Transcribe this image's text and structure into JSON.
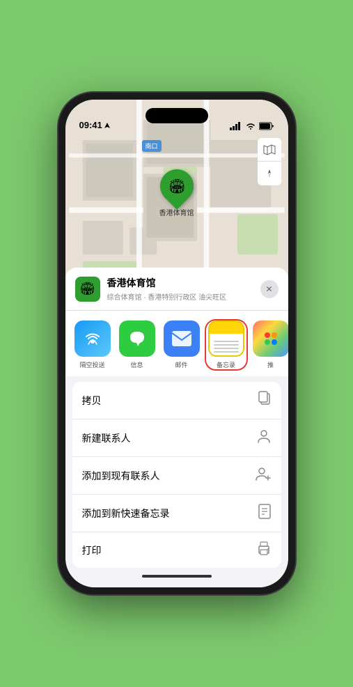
{
  "status_bar": {
    "time": "09:41",
    "location_arrow": "▶"
  },
  "map": {
    "label": "南口",
    "controls": {
      "map_icon": "🗺",
      "location_icon": "➤"
    },
    "pin": {
      "label": "香港体育馆",
      "emoji": "🏟"
    }
  },
  "venue_card": {
    "name": "香港体育馆",
    "subtitle": "综合体育馆 · 香港特别行政区 油尖旺区",
    "close_label": "✕"
  },
  "share_items": [
    {
      "id": "airdrop",
      "label": "隔空投送",
      "type": "airdrop"
    },
    {
      "id": "messages",
      "label": "信息",
      "type": "messages"
    },
    {
      "id": "mail",
      "label": "邮件",
      "type": "mail"
    },
    {
      "id": "notes",
      "label": "备忘录",
      "type": "notes",
      "selected": true
    },
    {
      "id": "more",
      "label": "推",
      "type": "more"
    }
  ],
  "actions": [
    {
      "id": "copy",
      "label": "拷贝",
      "icon": "copy"
    },
    {
      "id": "new-contact",
      "label": "新建联系人",
      "icon": "person"
    },
    {
      "id": "add-existing",
      "label": "添加到现有联系人",
      "icon": "person-add"
    },
    {
      "id": "add-notes",
      "label": "添加到新快速备忘录",
      "icon": "note"
    },
    {
      "id": "print",
      "label": "打印",
      "icon": "printer"
    }
  ]
}
